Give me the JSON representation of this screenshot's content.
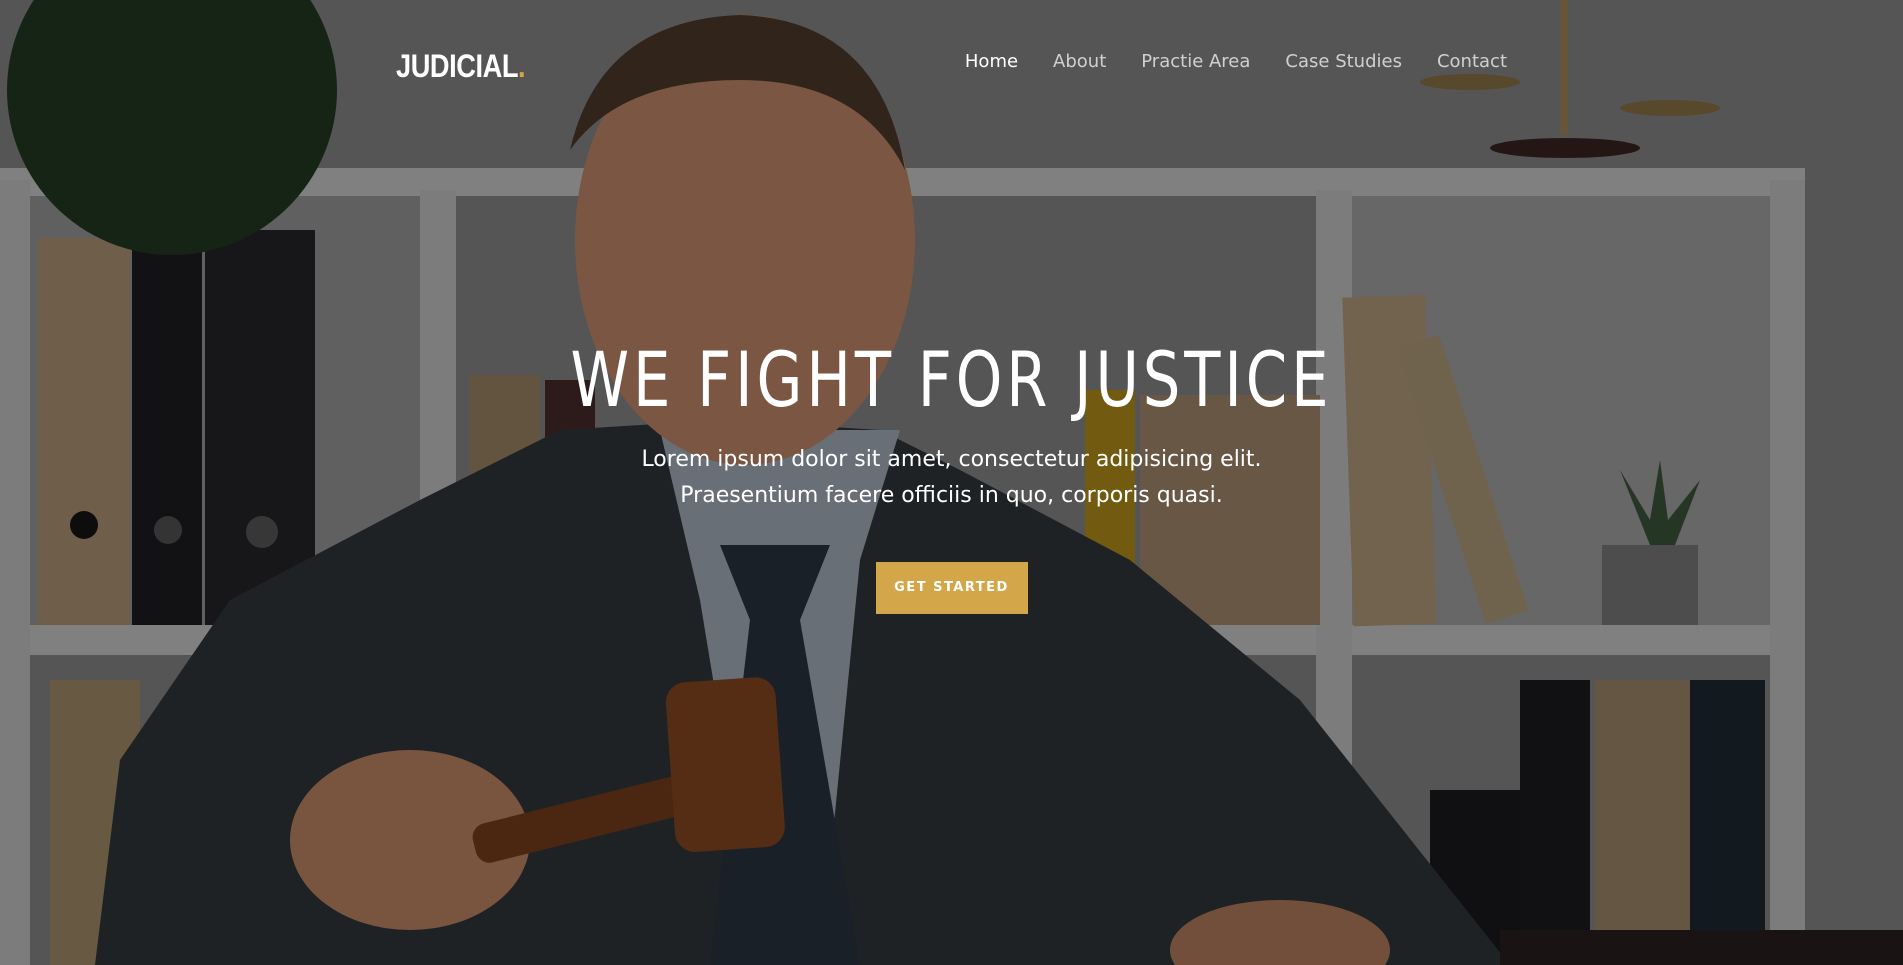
{
  "brand": {
    "name": "JUDICIAL",
    "dot": ".",
    "accent_color": "#d4a64a"
  },
  "nav": {
    "items": [
      {
        "label": "Home",
        "active": true
      },
      {
        "label": "About",
        "active": false
      },
      {
        "label": "Practie Area",
        "active": false
      },
      {
        "label": "Case Studies",
        "active": false
      },
      {
        "label": "Contact",
        "active": false
      }
    ]
  },
  "hero": {
    "title": "WE FIGHT FOR JUSTICE",
    "description_line1": "Lorem ipsum dolor sit amet, consectetur adipisicing elit.",
    "description_line2": "Praesentium facere officiis in quo, corporis quasi.",
    "cta_label": "GET STARTED",
    "background_image": "lawyer-with-gavel-photo"
  }
}
